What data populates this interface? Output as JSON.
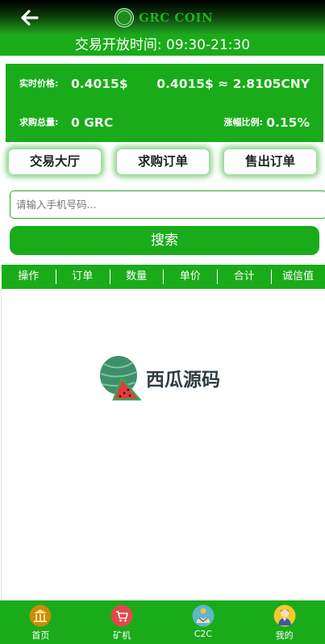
{
  "header": {
    "brand": "GRC COIN",
    "logo_emblem_text": "GRC"
  },
  "trading_hours": "交易开放时间: 09:30-21:30",
  "price_panel": {
    "realtime_price_label": "实时价格:",
    "realtime_price_value": "0.4015$",
    "conversion_text": "0.4015$ ≈ 2.8105CNY",
    "purchase_total_label": "求购总量:",
    "purchase_total_value": "0 GRC",
    "change_ratio_label": "涨幅比例:",
    "change_ratio_value": "0.15%"
  },
  "tabs": [
    {
      "label": "交易大厅"
    },
    {
      "label": "求购订单"
    },
    {
      "label": "售出订单"
    }
  ],
  "search": {
    "placeholder": "请输入手机号码...",
    "value": "",
    "button_label": "搜索"
  },
  "table": {
    "columns": [
      "操作",
      "订单",
      "数量",
      "单价",
      "合计",
      "诚信值"
    ]
  },
  "watermark": {
    "text": "西瓜源码"
  },
  "bottom_nav": [
    {
      "label": "首页",
      "icon": "bank-icon"
    },
    {
      "label": "矿机",
      "icon": "shopping-cart-icon"
    },
    {
      "label": "C2C",
      "icon": "c2c-trade-icon"
    },
    {
      "label": "我的",
      "icon": "user-avatar-icon"
    }
  ],
  "colors": {
    "brand_green": "#1aab1a",
    "header_dark": "#000000",
    "text_white": "#ffffff"
  }
}
